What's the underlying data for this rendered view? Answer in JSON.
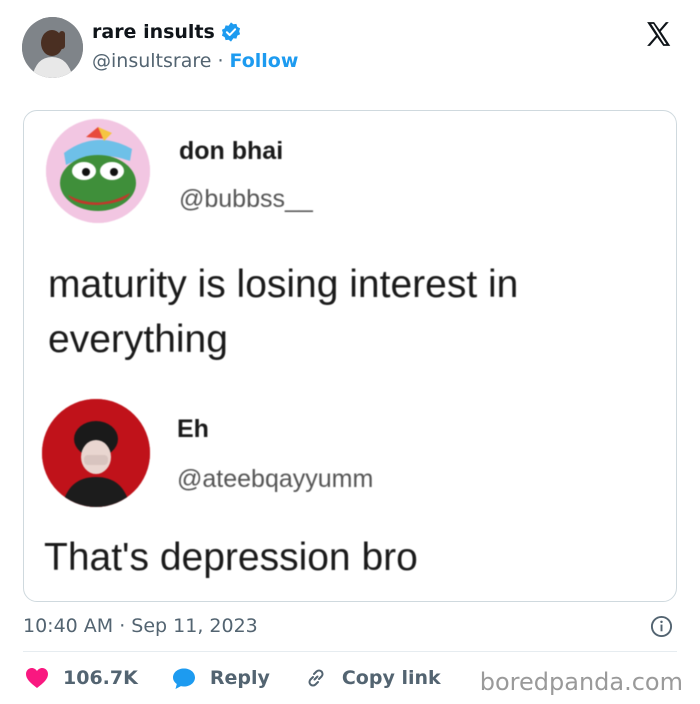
{
  "header": {
    "name": "rare insults",
    "handle": "@insultsrare",
    "separator": "·",
    "follow_label": "Follow"
  },
  "quoted": {
    "first": {
      "name": "don bhai",
      "handle": "@bubbss__",
      "text": "maturity is losing interest in everything"
    },
    "second": {
      "name": "Eh",
      "handle": "@ateebqayyumm",
      "text": "That's depression bro"
    }
  },
  "footer": {
    "timestamp": "10:40 AM · Sep 11, 2023",
    "likes": "106.7K",
    "reply_label": "Reply",
    "copy_label": "Copy link",
    "watermark": "boredpanda.com"
  },
  "colors": {
    "accent": "#1d9bf0",
    "like": "#f91880",
    "muted": "#536471"
  },
  "icons": [
    "verified-badge-icon",
    "x-logo-icon",
    "info-icon",
    "heart-icon",
    "reply-bubble-icon",
    "link-icon"
  ]
}
